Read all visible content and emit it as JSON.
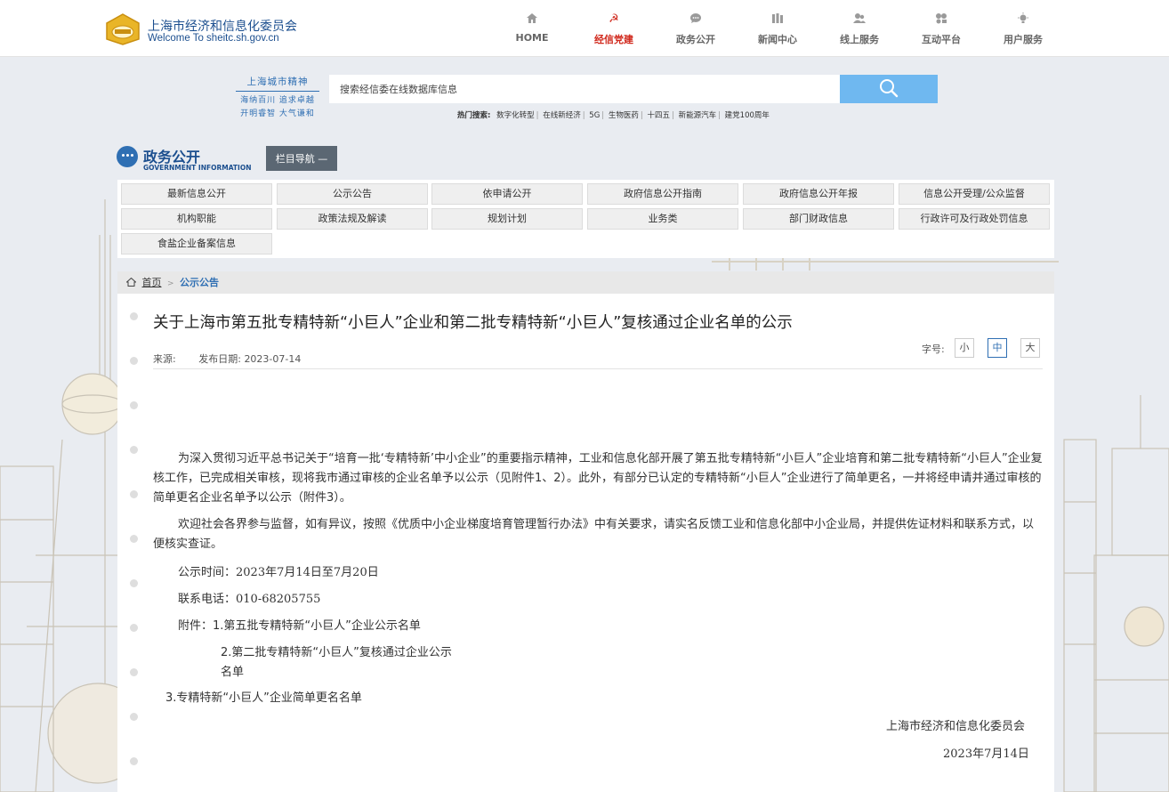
{
  "header": {
    "site_title": "上海市经济和信息化委员会",
    "site_subtitle": "Welcome To sheitc.sh.gov.cn",
    "nav": [
      {
        "label": "HOME",
        "icon": "home-icon",
        "active": false
      },
      {
        "label": "经信党建",
        "icon": "party-icon",
        "active": true
      },
      {
        "label": "政务公开",
        "icon": "chat-icon",
        "active": false
      },
      {
        "label": "新闻中心",
        "icon": "news-icon",
        "active": false
      },
      {
        "label": "线上服务",
        "icon": "users-icon",
        "active": false
      },
      {
        "label": "互动平台",
        "icon": "interact-icon",
        "active": false
      },
      {
        "label": "用户服务",
        "icon": "lightbulb-icon",
        "active": false
      }
    ],
    "accent_color": "#d0281c"
  },
  "spirit": {
    "title": "上海城市精神",
    "line1": "海纳百川 追求卓越",
    "line2": "开明睿智 大气谦和"
  },
  "search": {
    "placeholder": "搜索经信委在线数据库信息",
    "hot_label": "热门搜索:",
    "hot_terms": [
      "数字化转型",
      "在线新经济",
      "5G",
      "生物医药",
      "十四五",
      "新能源汽车",
      "建党100周年"
    ],
    "button_color": "#6fb8f0"
  },
  "section": {
    "title": "政务公开",
    "subtitle": "GOVERNMENT INFORMATION",
    "column_nav_label": "栏目导航 —"
  },
  "categories": [
    "最新信息公开",
    "公示公告",
    "依申请公开",
    "政府信息公开指南",
    "政府信息公开年报",
    "信息公开受理/公众监督",
    "机构职能",
    "政策法规及解读",
    "规划计划",
    "业务类",
    "部门财政信息",
    "行政许可及行政处罚信息",
    "食盐企业备案信息"
  ],
  "breadcrumb": {
    "home": "首页",
    "separator": ">",
    "current": "公示公告"
  },
  "article": {
    "title": "关于上海市第五批专精特新“小巨人”企业和第二批专精特新“小巨人”复核通过企业名单的公示",
    "source_label": "来源:",
    "date_label": "发布日期:",
    "date": "2023-07-14",
    "font_size_label": "字号:",
    "font_sizes": [
      "小",
      "中",
      "大"
    ],
    "font_size_selected": "中",
    "para1": "为深入贯彻习近平总书记关于“培育一批‘专精特新’中小企业”的重要指示精神，工业和信息化部开展了第五批专精特新“小巨人”企业培育和第二批专精特新“小巨人”企业复核工作，已完成相关审核，现将我市通过审核的企业名单予以公示（见附件1、2）。此外，有部分已认定的专精特新“小巨人”企业进行了简单更名，一并将经申请并通过审核的简单更名企业名单予以公示（附件3）。",
    "para2": "欢迎社会各界参与监督，如有异议，按照《优质中小企业梯度培育管理暂行办法》中有关要求，请实名反馈工业和信息化部中小企业局，并提供佐证材料和联系方式，以便核实查证。",
    "period_label": "公示时间：",
    "period_value": "2023年7月14日至7月20日",
    "phone_label": "联系电话：",
    "phone_value": "010-68205755",
    "attach_label": "附件：",
    "attach1": "1.第五批专精特新“小巨人”企业公示名单",
    "attach2_line1": "2.第二批专精特新“小巨人”复核通过企业公示",
    "attach2_line2": "名单",
    "attach3": "3.专精特新“小巨人”企业简单更名名单",
    "signature": "上海市经济和信息化委员会",
    "sign_date": "2023年7月14日"
  }
}
